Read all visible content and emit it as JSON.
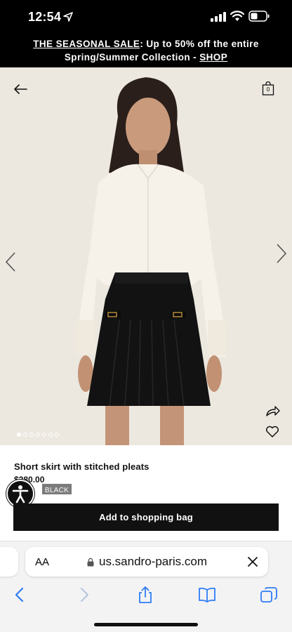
{
  "status_bar": {
    "time": "12:54"
  },
  "promo": {
    "sale_label": "THE SEASONAL SALE",
    "text": ": Up to 50% off the entire",
    "line2": "Spring/Summer Collection - ",
    "shop_link": "SHOP"
  },
  "header": {
    "bag_count": "0"
  },
  "carousel": {
    "total": 7,
    "active": 0
  },
  "product": {
    "name": "Short skirt with stitched pleats",
    "price": "$280.00",
    "color": "BLACK",
    "add_button": "Add to shopping bag"
  },
  "browser": {
    "text_size": "AA",
    "url": "us.sandro-paris.com"
  },
  "colors": {
    "accent": "#111111",
    "promo_bg": "#000000",
    "chip": "#7b7b7b"
  }
}
